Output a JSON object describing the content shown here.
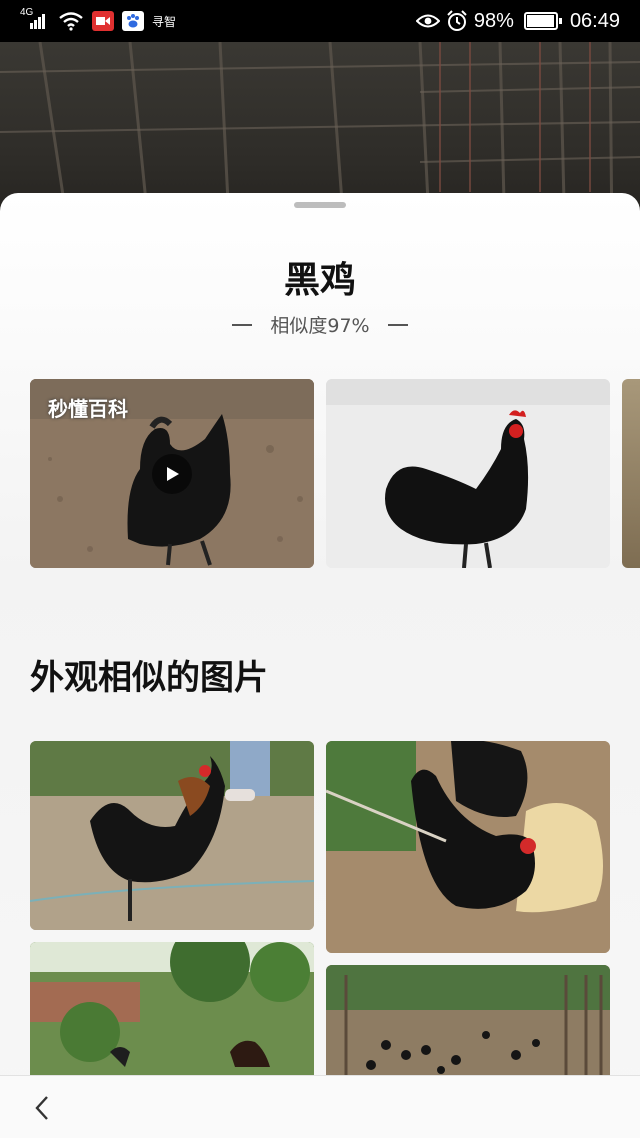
{
  "status_bar": {
    "network": "4G",
    "carrier_glyph": "寻智",
    "battery": "98%",
    "time": "06:49",
    "icons": [
      "signal-icon",
      "wifi-icon",
      "video-app-icon",
      "baidu-app-icon",
      "eye-icon",
      "alarm-icon",
      "battery-icon"
    ]
  },
  "result": {
    "title": "黑鸡",
    "similarity_label": "相似度97%"
  },
  "carousel": {
    "items": [
      {
        "watermark": "秒懂百科",
        "type": "video"
      },
      {
        "type": "image"
      },
      {
        "type": "image"
      }
    ]
  },
  "similar_section": {
    "title": "外观相似的图片",
    "images": [
      "black hen",
      "black hen",
      "garden",
      "chicken farm"
    ]
  },
  "colors": {
    "sheet_bg": "#f4f4f4",
    "status_bar_bg": "#000000",
    "title_color": "#111111"
  }
}
